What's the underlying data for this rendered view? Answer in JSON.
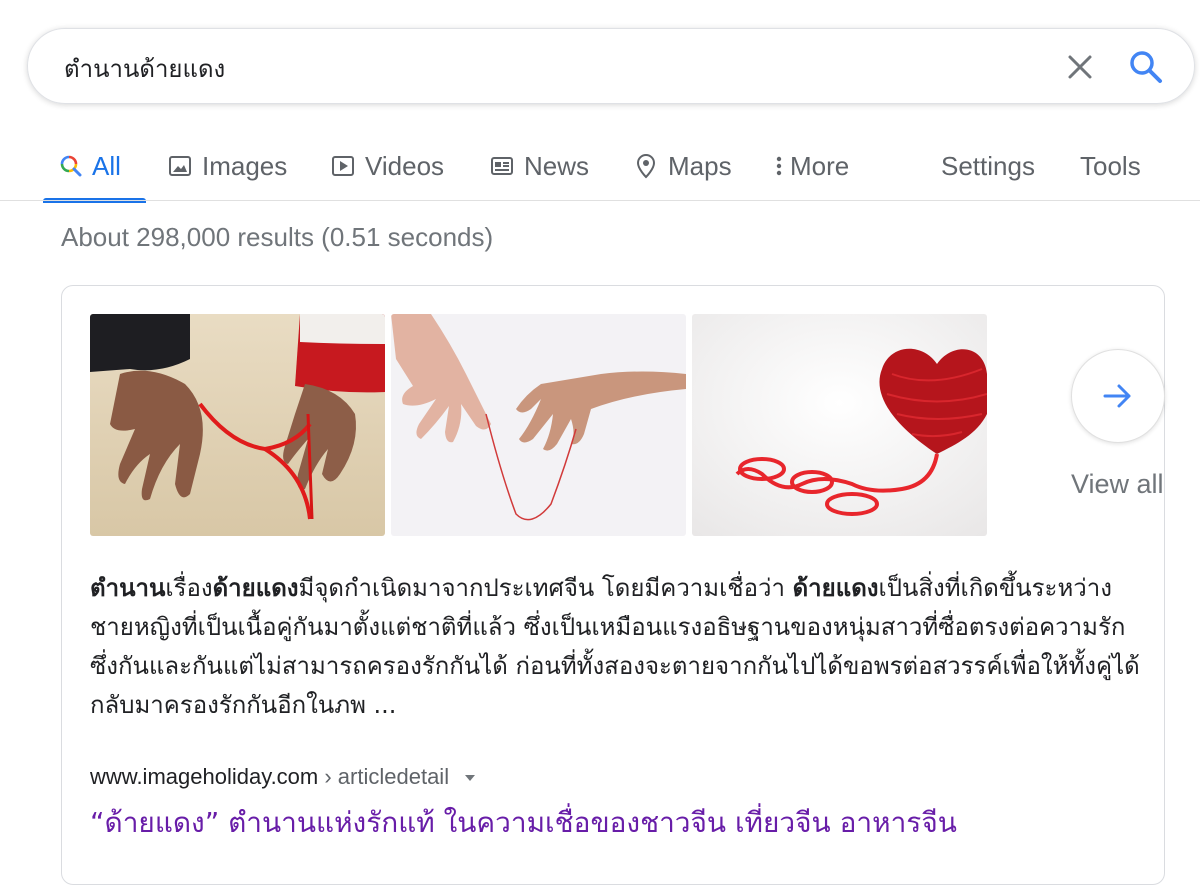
{
  "search": {
    "query": "ตำนานด้ายแดง"
  },
  "tabs": [
    {
      "label": "All",
      "icon": "search-multicolor-icon",
      "active": true
    },
    {
      "label": "Images",
      "icon": "image-icon"
    },
    {
      "label": "Videos",
      "icon": "play-icon"
    },
    {
      "label": "News",
      "icon": "newspaper-icon"
    },
    {
      "label": "Maps",
      "icon": "map-pin-icon"
    },
    {
      "label": "More",
      "icon": "more-vertical-icon"
    }
  ],
  "tools": {
    "settings_label": "Settings",
    "tools_label": "Tools"
  },
  "stats": "About 298,000 results (0.51 seconds)",
  "image_carousel": {
    "images": [
      {
        "alt": "hands tied with red thread"
      },
      {
        "alt": "hands reaching with red thread"
      },
      {
        "alt": "red yarn heart"
      }
    ],
    "view_all_label": "View all"
  },
  "result": {
    "snippet": [
      {
        "text": "ตำนาน",
        "bold": true
      },
      {
        "text": "เรื่อง",
        "bold": false
      },
      {
        "text": "ด้ายแดง",
        "bold": true
      },
      {
        "text": "มีจุดกำเนิดมาจากประเทศจีน โดยมีความเชื่อว่า ",
        "bold": false
      },
      {
        "text": "ด้ายแดง",
        "bold": true
      },
      {
        "text": "เป็นสิ่งที่เกิดขึ้นระหว่างชายหญิงที่เป็นเนื้อคู่กันมาตั้งแต่ชาติที่แล้ว ซึ่งเป็นเหมือนแรงอธิษฐานของหนุ่มสาวที่ซื่อตรงต่อความรักซึ่งกันและกันแต่ไม่สามารถครองรักกันได้ ก่อนที่ทั้งสองจะตายจากกันไปได้ขอพรต่อสวรรค์เพื่อให้ทั้งคู่ได้กลับมาครองรักกันอีกในภพ ...",
        "bold": false
      }
    ],
    "site": "www.imageholiday.com",
    "path": " › articledetail",
    "title": "“ด้ายแดง” ตำนานแห่งรักแท้ ในความเชื่อของชาวจีน เที่ยวจีน อาหารจีน"
  },
  "colors": {
    "accent": "#1a73e8",
    "visited_link": "#681da8",
    "muted": "#70757a"
  }
}
